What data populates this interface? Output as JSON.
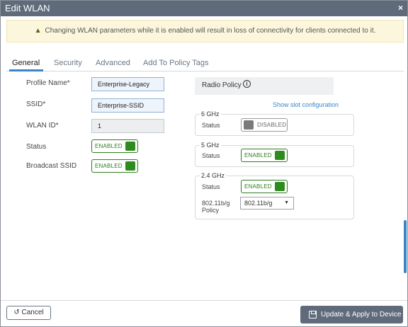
{
  "window": {
    "title": "Edit WLAN",
    "close_glyph": "×"
  },
  "warning": {
    "icon": "warning-icon",
    "text": "Changing WLAN parameters while it is enabled will result in loss of connectivity for clients connected to it."
  },
  "tabs": [
    {
      "label": "General",
      "active": true
    },
    {
      "label": "Security"
    },
    {
      "label": "Advanced"
    },
    {
      "label": "Add To Policy Tags"
    }
  ],
  "general": {
    "profile_name": {
      "label": "Profile Name*",
      "value": "Enterprise-Legacy"
    },
    "ssid": {
      "label": "SSID*",
      "value": "Enterprise-SSID"
    },
    "wlan_id": {
      "label": "WLAN ID*",
      "value": "1"
    },
    "status": {
      "label": "Status",
      "value": "ENABLED"
    },
    "broadcast_ssid": {
      "label": "Broadcast SSID",
      "value": "ENABLED"
    }
  },
  "radio_policy": {
    "title": "Radio Policy",
    "info_icon": "i",
    "show_slot_link": "Show slot configuration",
    "band_6ghz": {
      "name": "6 GHz",
      "status_label": "Status",
      "status": "DISABLED"
    },
    "band_5ghz": {
      "name": "5 GHz",
      "status_label": "Status",
      "status": "ENABLED"
    },
    "band_24ghz": {
      "name": "2.4 GHz",
      "status_label": "Status",
      "status": "ENABLED",
      "policy_label_line1": "802.11b/g",
      "policy_label_line2": "Policy",
      "policy_value": "802.11b/g"
    }
  },
  "footer": {
    "cancel_label": "Cancel",
    "cancel_icon_glyph": "↺",
    "apply_label": "Update & Apply to Device"
  },
  "colors": {
    "titlebar": "#5f6b7a",
    "accent": "#3a86c8",
    "enabled": "#2e8b1e",
    "warning_bg": "#fcf7dc"
  }
}
